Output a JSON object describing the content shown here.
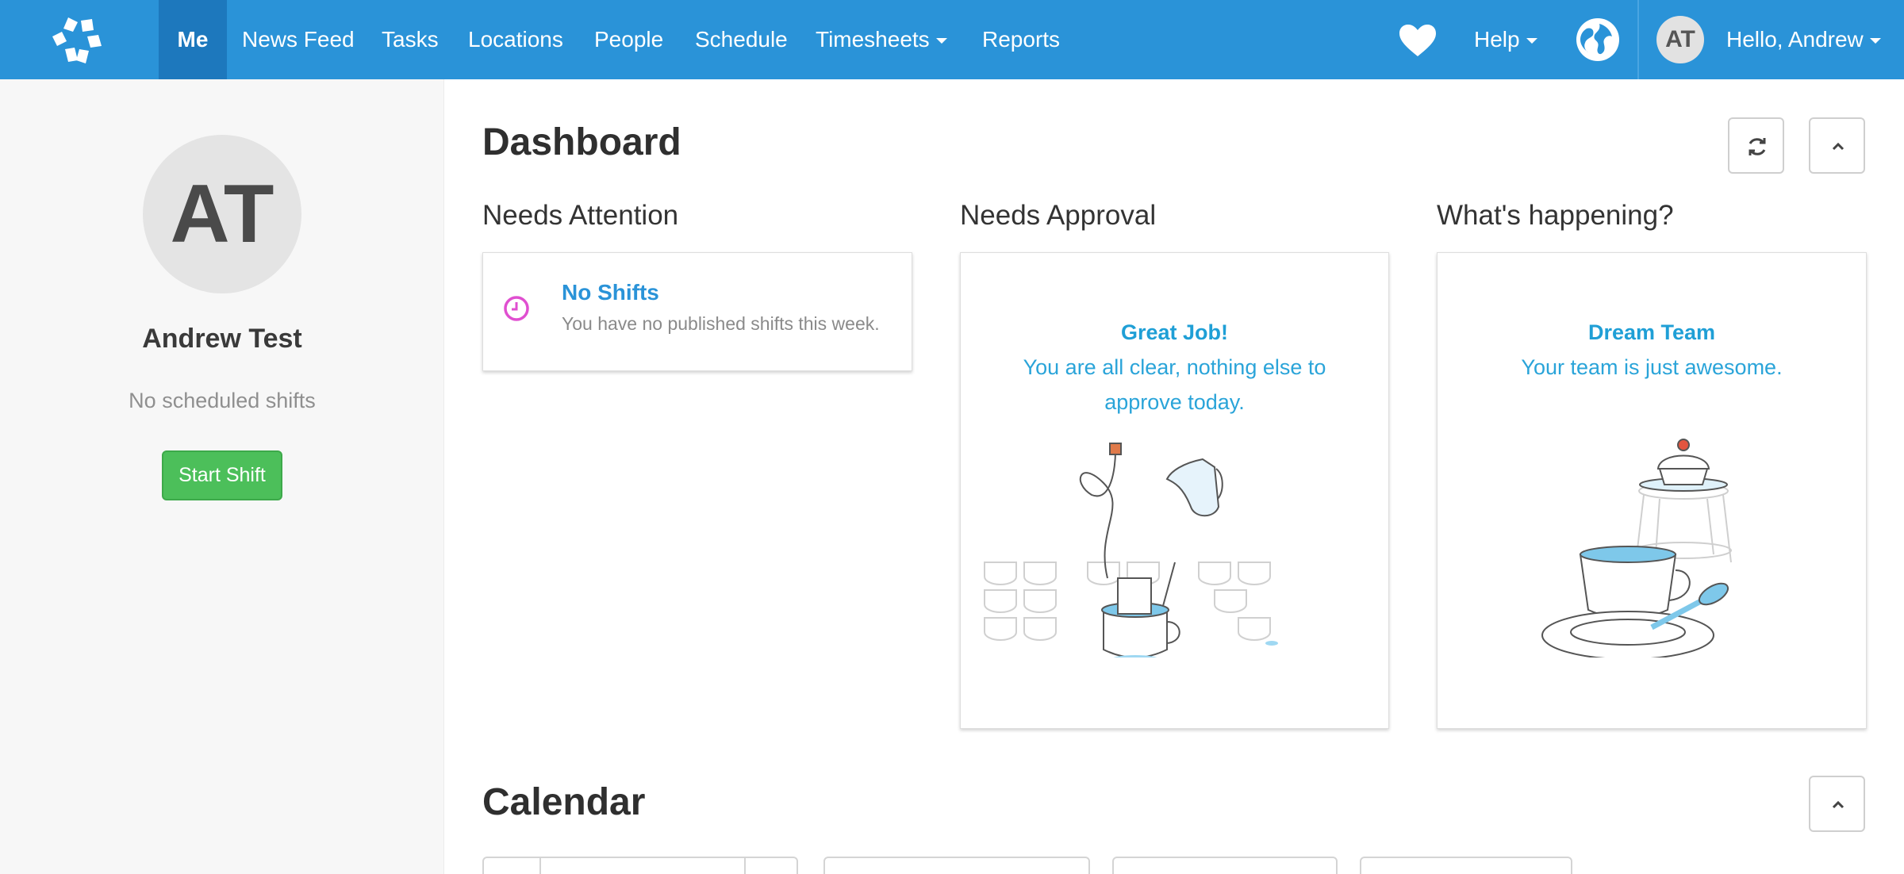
{
  "nav": {
    "items": [
      {
        "label": "Me"
      },
      {
        "label": "News Feed"
      },
      {
        "label": "Tasks"
      },
      {
        "label": "Locations"
      },
      {
        "label": "People"
      },
      {
        "label": "Schedule"
      },
      {
        "label": "Timesheets"
      },
      {
        "label": "Reports"
      }
    ],
    "help_label": "Help",
    "user_initials": "AT",
    "greeting": "Hello, Andrew"
  },
  "sidebar": {
    "initials": "AT",
    "name": "Andrew Test",
    "shifts_text": "No scheduled shifts",
    "start_shift_label": "Start Shift"
  },
  "dashboard": {
    "title": "Dashboard",
    "needs_attention": {
      "title": "Needs Attention",
      "item_title": "No Shifts",
      "item_text": "You have no published shifts this week."
    },
    "needs_approval": {
      "title": "Needs Approval",
      "card_title": "Great Job!",
      "card_line1": "You are all clear, nothing else to",
      "card_line2": "approve today."
    },
    "whats_happening": {
      "title": "What's happening?",
      "card_title": "Dream Team",
      "card_line1": "Your team is just awesome."
    }
  },
  "calendar": {
    "title": "Calendar"
  },
  "colors": {
    "nav_bg": "#2a93d8",
    "nav_active": "#1d78bd",
    "start_shift": "#4cbf5a",
    "link_blue": "#2a93d8",
    "clock_pink": "#e04fd0"
  }
}
